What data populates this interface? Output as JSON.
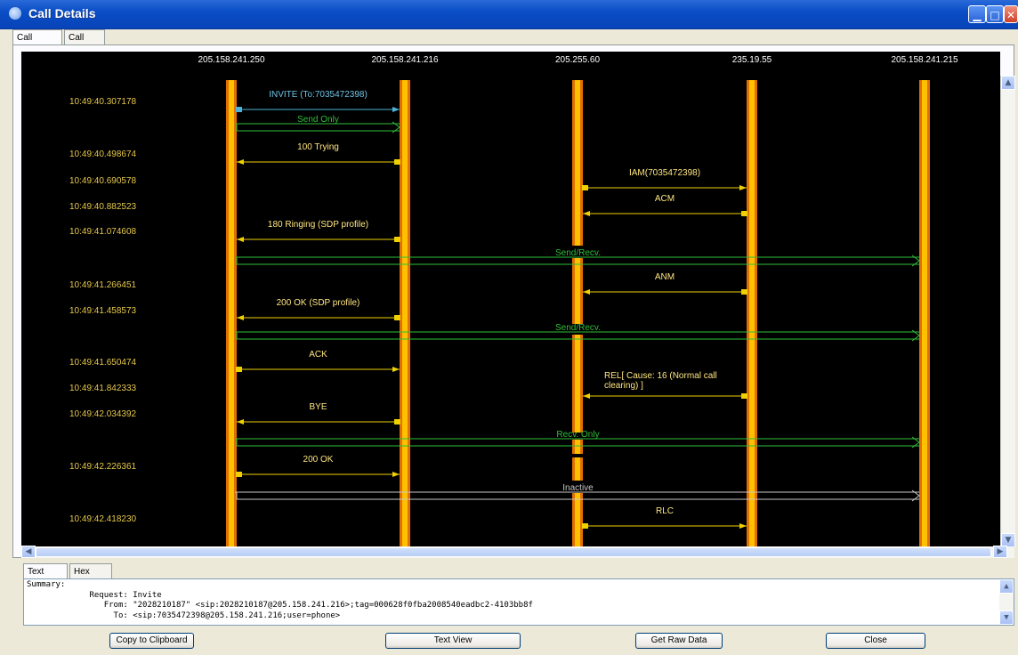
{
  "window": {
    "title": "Call Details"
  },
  "top_tabs": [
    "Call Ladder",
    "Call Info"
  ],
  "ladder": {
    "hosts": [
      "205.158.241.250",
      "205.158.241.216",
      "205.255.60",
      "235.19.55",
      "205.158.241.215"
    ],
    "timestamps": [
      "10:49:40.307178",
      "10:49:40.498674",
      "10:49:40.690578",
      "10:49:40.882523",
      "10:49:41.074608",
      "10:49:41.266451",
      "10:49:41.458573",
      "10:49:41.650474",
      "10:49:41.842333",
      "10:49:42.034392",
      "10:49:42.226361",
      "10:49:42.418230"
    ],
    "messages": [
      {
        "label": "INVITE (To:7035472398)",
        "from": 0,
        "to": 1,
        "color": "#4fb3d9"
      },
      {
        "label": "100 Trying",
        "from": 1,
        "to": 0,
        "color": "#f0d000"
      },
      {
        "label": "IAM(7035472398)",
        "from": 2,
        "to": 3,
        "color": "#f0d000"
      },
      {
        "label": "ACM",
        "from": 3,
        "to": 2,
        "color": "#f0d000"
      },
      {
        "label": "180 Ringing (SDP profile)",
        "from": 1,
        "to": 0,
        "color": "#f0d000"
      },
      {
        "label": "ANM",
        "from": 3,
        "to": 2,
        "color": "#f0d000"
      },
      {
        "label": "200 OK (SDP profile)",
        "from": 1,
        "to": 0,
        "color": "#f0d000"
      },
      {
        "label": "ACK",
        "from": 0,
        "to": 1,
        "color": "#f0d000"
      },
      {
        "label": "REL[ Cause: 16 (Normal call",
        "label2": "clearing) ]",
        "from": 3,
        "to": 2,
        "color": "#f0d000"
      },
      {
        "label": "BYE",
        "from": 1,
        "to": 0,
        "color": "#f0d000"
      },
      {
        "label": "200 OK",
        "from": 0,
        "to": 1,
        "color": "#f0d000"
      },
      {
        "label": "RLC",
        "from": 2,
        "to": 3,
        "color": "#f0d000"
      }
    ],
    "media": [
      {
        "label": "Send Only",
        "from": 0,
        "to": 1,
        "color": "#2fbf3a"
      },
      {
        "label": "Send/Recv.",
        "from": 0,
        "to": 4,
        "color": "#2fbf3a"
      },
      {
        "label": "Send/Recv.",
        "from": 0,
        "to": 4,
        "color": "#2fbf3a"
      },
      {
        "label": "Recv. Only",
        "from": 0,
        "to": 4,
        "color": "#2fbf3a"
      },
      {
        "label": "Inactive",
        "from": 0,
        "to": 4,
        "color": "#c8c8c8"
      }
    ]
  },
  "bottom_tabs": [
    "Text Data",
    "Hex Data"
  ],
  "text_data": {
    "lines": [
      "Summary:",
      "             Request: Invite",
      "                From: \"2028210187\" <sip:2028210187@205.158.241.216>;tag=000628f0fba2008540eadbc2-4103bb8f",
      "                  To: <sip:7035472398@205.158.241.216;user=phone>"
    ]
  },
  "buttons": {
    "copy": "Copy to Clipboard",
    "text_view": "Text View",
    "raw": "Get Raw Data",
    "close": "Close"
  },
  "colors": {
    "lifeline": "#ffc000",
    "lifeline_edge": "#e07000",
    "timestamp": "#e6c84a",
    "host_label": "#ffffff"
  }
}
